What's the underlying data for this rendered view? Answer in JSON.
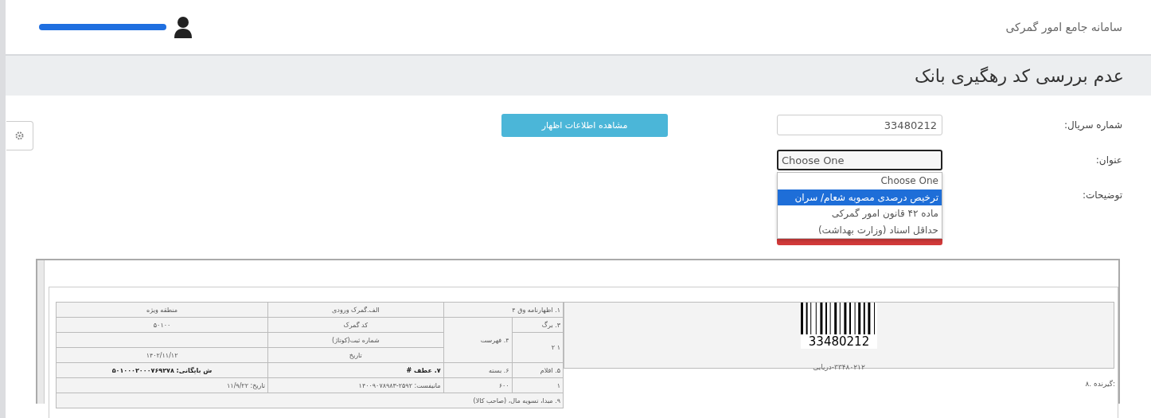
{
  "header": {
    "app_title": "سامانه جامع امور گمرکی"
  },
  "page_title": "عدم بررسی کد رهگیری بانک",
  "form": {
    "serial": {
      "label": "شماره سریال:",
      "value": "33480212"
    },
    "subject": {
      "label": "عنوان:",
      "value": "Choose One",
      "expanded": true,
      "options": [
        {
          "label": "Choose One",
          "highlighted": false
        },
        {
          "label": "ترخیص درصدی مصوبه شعام/ سران",
          "highlighted": true
        },
        {
          "label": "ماده ۴۲ قانون امور گمرکی",
          "highlighted": false
        },
        {
          "label": "حداقل اسناد (وزارت بهداشت)",
          "highlighted": false
        }
      ]
    },
    "notes": {
      "label": "توضیحات:"
    },
    "view_button": "مشاهده اطلاعات اظهار"
  },
  "document": {
    "barcode": "33480212",
    "barcode_caption": "۳۳۴۸۰۲۱۲-دریایی",
    "receiver": "۸. گیرنده:",
    "cells": {
      "declaration": "۱. اظهارنامه وق ۴",
      "sheet": "۳. برگ",
      "list": "۴. فهرست",
      "sheet_no": "۱",
      "sheet_total": "۲",
      "customs_in": "الف.گمرک ورودی",
      "zone": "منطقه ویژه",
      "customs_code_label": "کد گمرک",
      "customs_code": "۵۰۱۰۰",
      "reg_label": "شماره ثبت(کوتاژ)",
      "date_label": "تاریخ",
      "date": "۱۴۰۲/۱۱/۱۲",
      "items_label": "۵. اقلام",
      "packages_label": "۶. بسته",
      "items": "۱",
      "packages": "۶۰۰",
      "ref": "۷. عطف #",
      "archive": "ش بایگانی: ۵۰۱۰۰۰۲۰۰۰۷۶۹۲۷۸",
      "manifest": "مانیفست: ۲۵۹۲-۱۴۰۰۹۰۷۸۹۸۳",
      "ref_date": "تاریخ: ۱۱/۹/۲۲",
      "origin": "۹. مبدا، تسویه مال، (صاحب کالا)"
    }
  }
}
